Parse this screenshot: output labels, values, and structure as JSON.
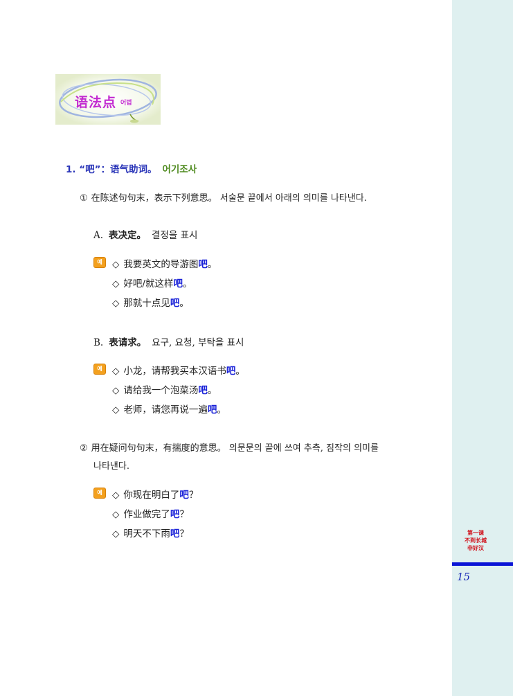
{
  "badge": {
    "title": "语法点",
    "subtitle": "어법"
  },
  "heading": {
    "zh": "1. “吧”：语气助词。",
    "ko": "어기조사"
  },
  "point1": {
    "marker": "①",
    "text": "在陈述句句末，表示下列意思。 서술문 끝에서 아래의 의미를 나타낸다."
  },
  "sectionA": {
    "letter": "A.",
    "zh": "表决定。",
    "ko": "결정을 표시",
    "icon_label": "예",
    "examples": [
      {
        "pre": "我要英文的导游图",
        "hl": "吧",
        "post": "。"
      },
      {
        "pre": "好吧/就这样",
        "hl": "吧",
        "post": "。"
      },
      {
        "pre": "那就十点见",
        "hl": "吧",
        "post": "。"
      }
    ]
  },
  "sectionB": {
    "letter": "B.",
    "zh": "表请求。",
    "ko": "요구, 요청, 부탁을 표시",
    "icon_label": "예",
    "examples": [
      {
        "pre": "小龙，请帮我买本汉语书",
        "hl": "吧",
        "post": "。"
      },
      {
        "pre": "请给我一个泡菜汤",
        "hl": "吧",
        "post": "。"
      },
      {
        "pre": "老师，请您再说一遍",
        "hl": "吧",
        "post": "。"
      }
    ]
  },
  "point2": {
    "marker": "②",
    "line1": "用在疑问句句末，有揣度的意思。 의문문의 끝에 쓰여 추측, 짐작의 의미를",
    "line2": "나타낸다.",
    "icon_label": "예",
    "examples": [
      {
        "pre": "你现在明白了",
        "hl": "吧",
        "post": "？"
      },
      {
        "pre": "作业做完了",
        "hl": "吧",
        "post": "？"
      },
      {
        "pre": "明天不下雨",
        "hl": "吧",
        "post": "？"
      }
    ]
  },
  "diamond": "◇",
  "sidebar": {
    "lesson_lines": [
      "第一课",
      "不到长城",
      "非好汉"
    ],
    "page_number": "15"
  },
  "colors": {
    "accent_blue": "#2a35b8",
    "highlight_blue": "#1a22d8",
    "korean_green": "#4e8a1e",
    "badge_purple": "#c22ad0",
    "sidebar_bg": "#dff0f0",
    "sidebar_red": "#d0101a",
    "icon_orange": "#f3a01e"
  }
}
